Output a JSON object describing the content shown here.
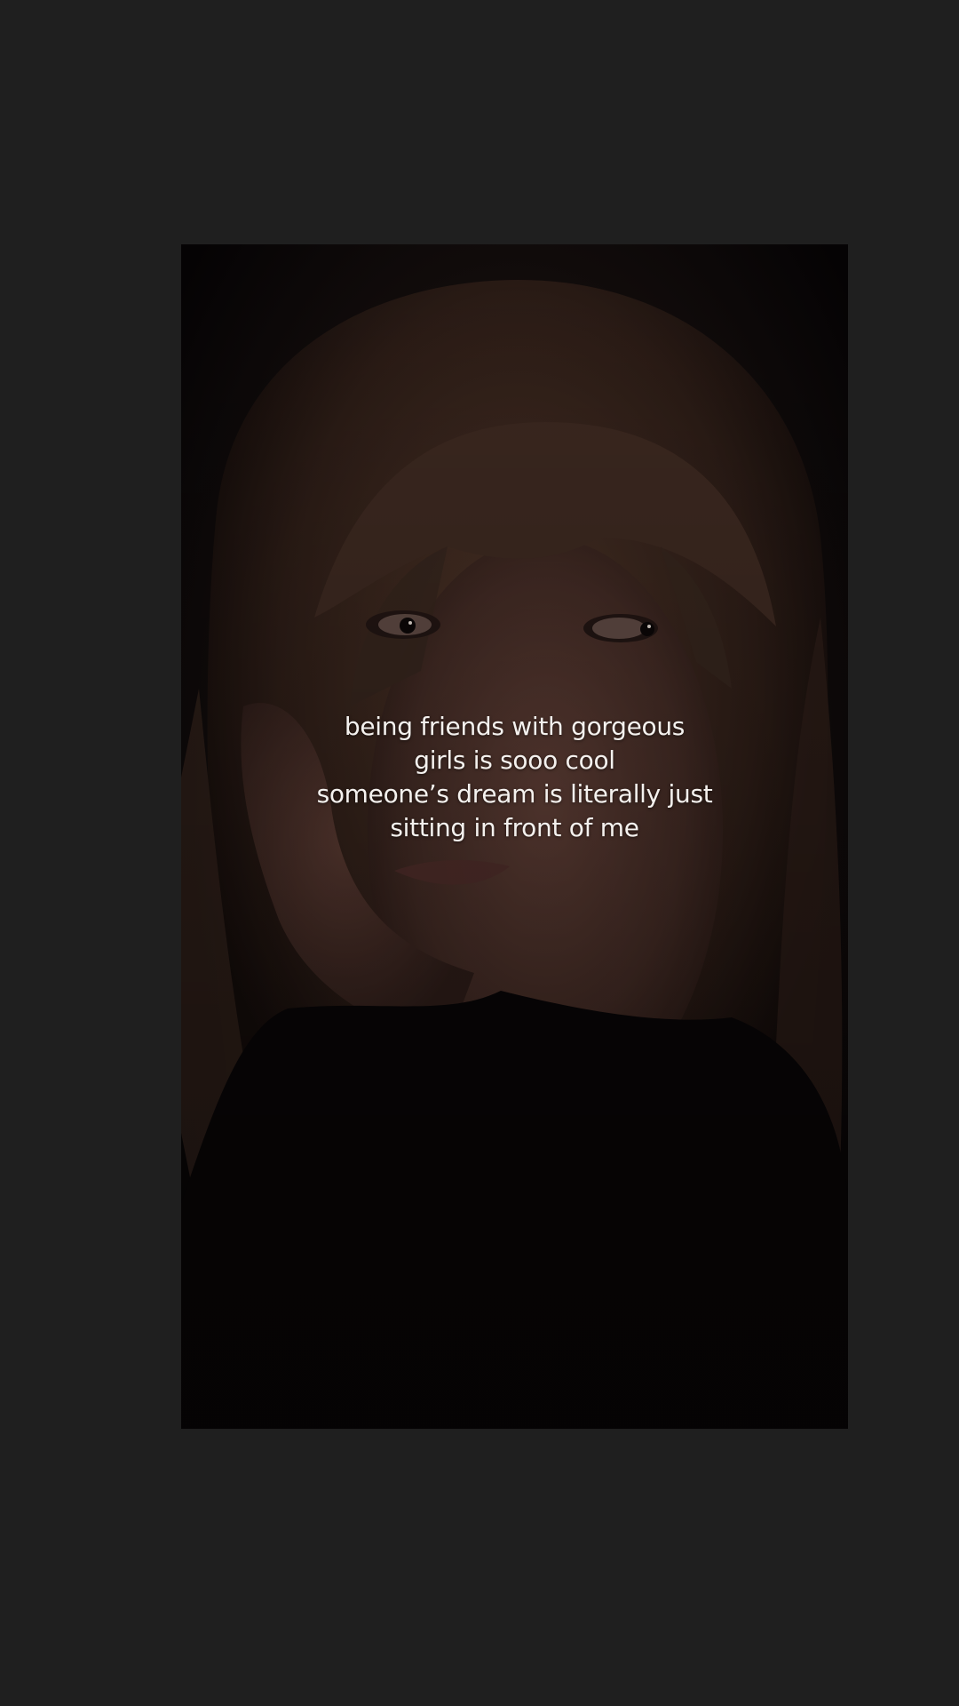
{
  "video": {
    "caption_lines": [
      "being friends with gorgeous",
      "girls is sooo cool",
      "someone’s dream is literally just",
      "sitting in front of me"
    ]
  },
  "colors": {
    "page_background": "#1f1f1f",
    "caption_text": "#f4f1ee"
  }
}
